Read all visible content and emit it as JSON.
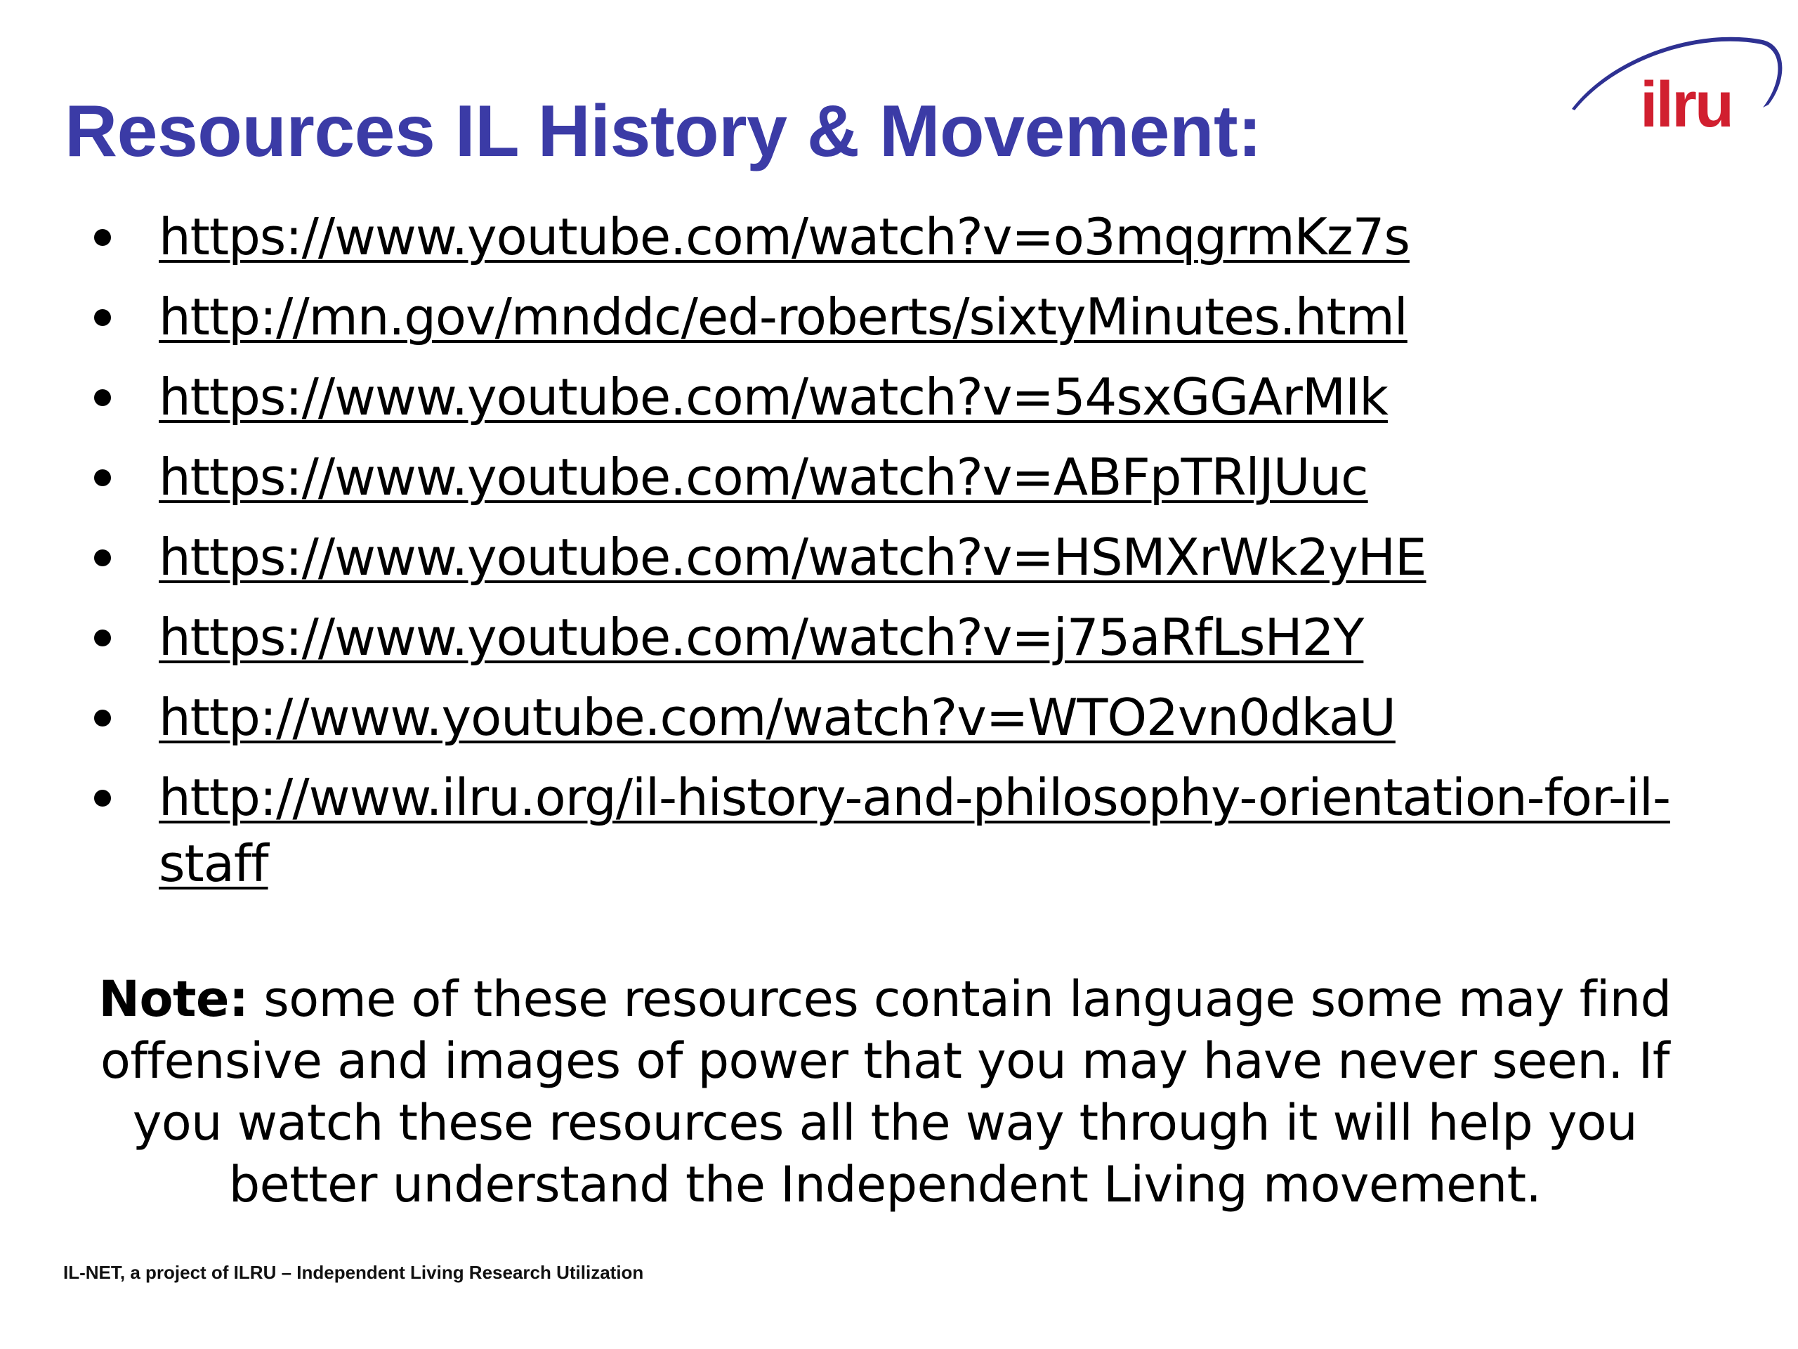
{
  "slide": {
    "title": "Resources IL History & Movement:",
    "logo_text": "ilru",
    "links": [
      "https://www.youtube.com/watch?v=o3mqgrmKz7s",
      "http://mn.gov/mnddc/ed-roberts/sixtyMinutes.html",
      "https://www.youtube.com/watch?v=54sxGGArMIk",
      "https://www.youtube.com/watch?v=ABFpTRlJUuc",
      "https://www.youtube.com/watch?v=HSMXrWk2yHE",
      "https://www.youtube.com/watch?v=j75aRfLsH2Y",
      "http://www.youtube.com/watch?v=WTO2vn0dkaU",
      "http://www.ilru.org/il-history-and-philosophy-orientation-for-il-staff"
    ],
    "note_label": "Note:",
    "note_text": " some of these resources contain language some may find offensive and images of power that you may have never seen. If you watch these resources all the way through it will help you better understand the Independent Living movement.",
    "footer": "IL-NET, a project of ILRU – Independent Living Research Utilization"
  },
  "colors": {
    "title": "#3b3ba6",
    "logo_arc": "#2e3192",
    "logo_text": "#d11f2f"
  }
}
